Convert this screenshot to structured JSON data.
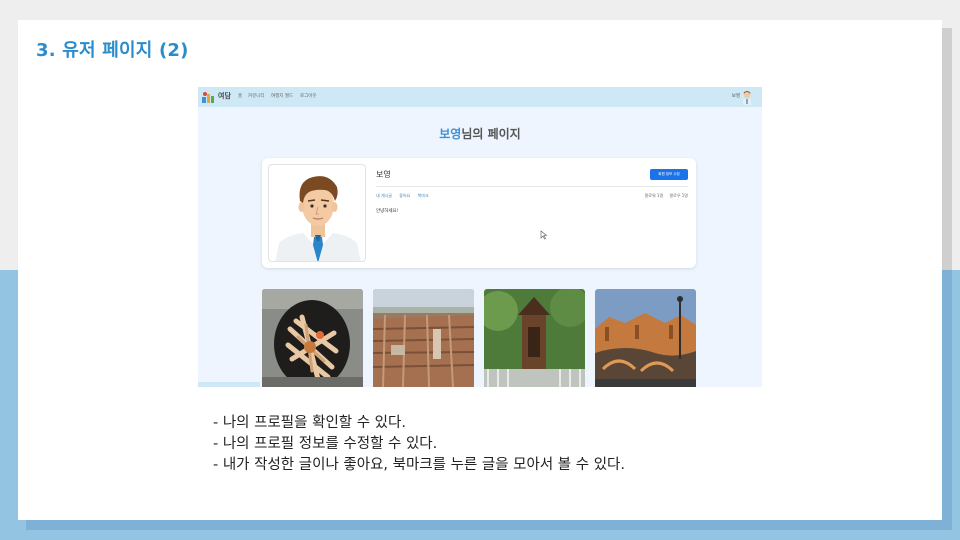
{
  "slide": {
    "title": "3. 유저 페이지 (2)",
    "bullets": [
      "- 나의 프로필을 확인할 수 있다.",
      "- 나의 프로필 정보를 수정할 수 있다.",
      "- 내가 작성한 글이나 좋아요, 북마크를 누른 글을 모아서 볼 수 있다."
    ]
  },
  "app": {
    "brand": "여담",
    "nav": [
      "홈",
      "커뮤니티",
      "여행지 월드",
      "로그아웃"
    ],
    "user_name": "보영",
    "page_title_highlight": "보영",
    "page_title_suffix": "님의 페이지",
    "profile": {
      "name": "보영",
      "edit_button": "회원 정보 수정",
      "tabs": [
        "내 게시글",
        "좋아요",
        "북마크"
      ],
      "followers": "팔로워 1명",
      "following": "팔로우 1명",
      "greeting": "안녕하세요!"
    },
    "photos": [
      "crab-dish",
      "city-aerial",
      "shrine",
      "plaza-bridge"
    ]
  },
  "colors": {
    "title_blue": "#2b8ccc",
    "nav_bg": "#cfe8f6",
    "button_blue": "#1a73e8",
    "highlight_blue": "#3d8fd6"
  }
}
